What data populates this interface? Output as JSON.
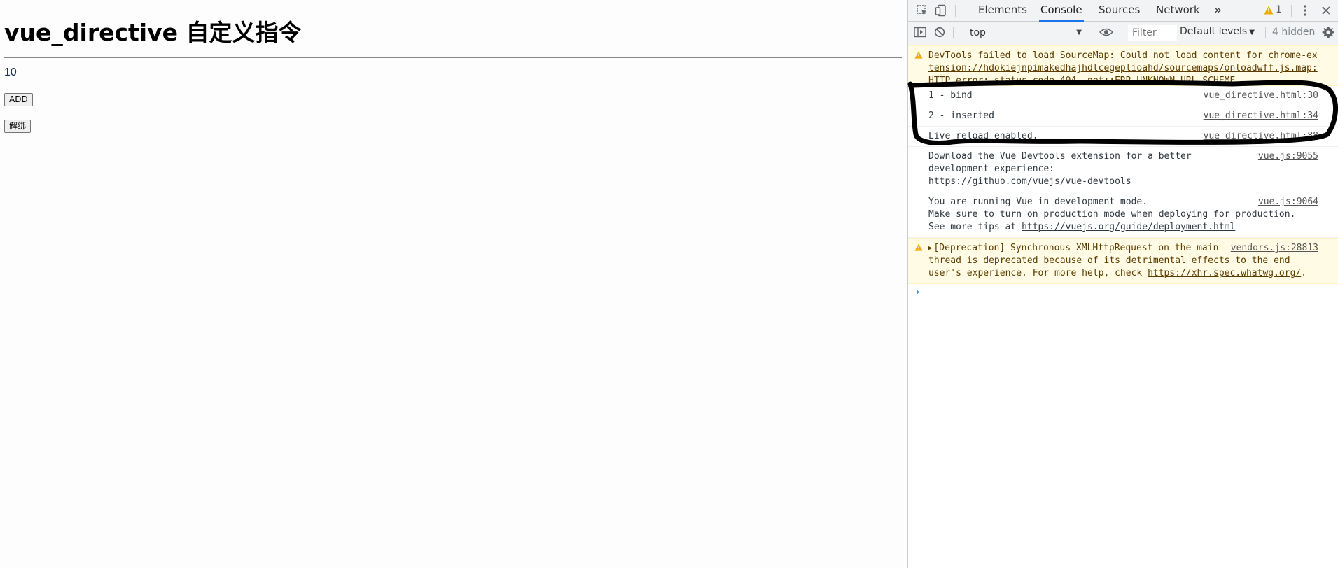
{
  "page": {
    "title": "vue_directive 自定义指令",
    "counter": "10",
    "add_button": "ADD",
    "unbind_button": "解绑"
  },
  "devtools": {
    "tabs": [
      "Elements",
      "Console",
      "Sources",
      "Network"
    ],
    "active_tab": "Console",
    "more_tabs_icon": "double-chevron-icon",
    "warning_count": "1",
    "toolbar": {
      "context": "top",
      "filter_placeholder": "Filter",
      "levels": "Default levels",
      "hidden": "4 hidden"
    },
    "messages": {
      "sourcemap": {
        "text": "DevTools failed to load SourceMap: Could not load content for ",
        "link": "chrome-extension://hdokiejnpimakedhajhdlcegeplioahd/sourcemaps/onloadwff.js.map",
        "tail": ": HTTP error: status code 404, net::ERR_UNKNOWN_URL_SCHEME"
      },
      "bind": {
        "text": "1 - bind",
        "source": "vue_directive.html:30"
      },
      "inserted": {
        "text": "2 - inserted",
        "source": "vue_directive.html:34"
      },
      "live": {
        "text": "Live reload enabled.",
        "source": "vue_directive.html:88"
      },
      "devtools": {
        "text": "Download the Vue Devtools extension for a better development experience:",
        "link": "https://github.com/vuejs/vue-devtools",
        "source": "vue.js:9055"
      },
      "devmode": {
        "text": "You are running Vue in development mode.\nMake sure to turn on production mode when deploying for production.\nSee more tips at ",
        "link": "https://vuejs.org/guide/deployment.html",
        "source": "vue.js:9064"
      },
      "deprecation": {
        "text": "[Deprecation] Synchronous XMLHttpRequest on the main thread is deprecated because of its detrimental effects to the end user's experience. For more help, check ",
        "link": "https://xhr.spec.whatwg.org/",
        "tail": ".",
        "source": "vendors.js:28813"
      }
    },
    "prompt": "›"
  },
  "colors": {
    "accent": "#1a73e8",
    "warning_bg": "#fffbe5",
    "warning_icon": "#f2a600"
  }
}
